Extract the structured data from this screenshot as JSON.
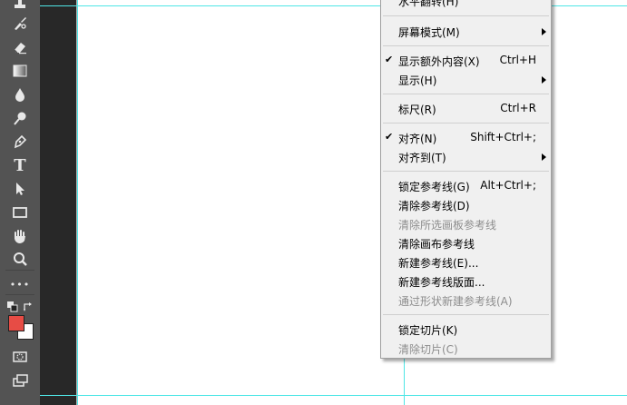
{
  "toolbar": {
    "tools": [
      {
        "name": "stamp-tool-icon"
      },
      {
        "name": "history-brush-icon"
      },
      {
        "name": "eraser-icon"
      },
      {
        "name": "gradient-icon"
      },
      {
        "name": "blur-drop-icon"
      },
      {
        "name": "dodge-icon"
      },
      {
        "name": "pen-icon"
      },
      {
        "name": "type-icon",
        "glyph": "T"
      },
      {
        "name": "path-selection-icon"
      },
      {
        "name": "rectangle-icon"
      },
      {
        "name": "hand-icon"
      },
      {
        "name": "zoom-icon"
      },
      {
        "name": "more-tools-icon",
        "glyph": "•••"
      }
    ],
    "foreground_color": "#e74c45",
    "background_color": "#ffffff"
  },
  "menu": {
    "items": {
      "flip_horizontal": "水平翻转(H)",
      "screen_mode": "屏幕模式(M)",
      "show_extras": "显示额外内容(X)",
      "show_extras_shortcut": "Ctrl+H",
      "show": "显示(H)",
      "rulers": "标尺(R)",
      "rulers_shortcut": "Ctrl+R",
      "snap": "对齐(N)",
      "snap_shortcut": "Shift+Ctrl+;",
      "snap_to": "对齐到(T)",
      "lock_guides": "锁定参考线(G)",
      "lock_guides_shortcut": "Alt+Ctrl+;",
      "clear_guides": "清除参考线(D)",
      "clear_artboard_guides": "清除所选画板参考线",
      "clear_canvas_guides": "清除画布参考线",
      "new_guide": "新建参考线(E)...",
      "new_guide_layout": "新建参考线版面...",
      "new_guides_from_shape": "通过形状新建参考线(A)",
      "lock_slices": "锁定切片(K)",
      "clear_slices": "清除切片(C)"
    },
    "check_mark": "✔"
  }
}
